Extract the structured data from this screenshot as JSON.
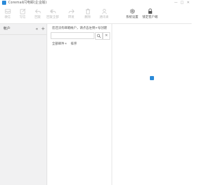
{
  "app": {
    "title": "Coremail闪电邮(企业版)"
  },
  "window_controls": [
    "—",
    "□",
    "✕"
  ],
  "toolbar": {
    "items": [
      {
        "label": "收信",
        "icon": "inbox-icon",
        "active": false
      },
      {
        "label": "写信",
        "icon": "compose-icon",
        "active": false
      },
      {
        "label": "回复",
        "icon": "reply-icon",
        "active": false
      },
      {
        "label": "回复全部",
        "icon": "reply-all-icon",
        "active": false
      },
      {
        "label": "转发",
        "icon": "forward-icon",
        "active": false
      },
      {
        "label": "删除",
        "icon": "delete-icon",
        "active": false
      },
      {
        "label": "通讯录",
        "icon": "contacts-icon",
        "active": false
      },
      {
        "label": "系统设置",
        "icon": "gear-icon",
        "active": true
      },
      {
        "label": "锁定客户端",
        "icon": "lock-icon",
        "active": true
      }
    ]
  },
  "left_panel": {
    "title": "帐户",
    "collapse_label": "«",
    "add_label": "+"
  },
  "middle_panel": {
    "notice": "您还没有邮箱帐户，请点击左侧+号创建",
    "search_placeholder": "",
    "search_button": "🔍",
    "clear_button": "✕",
    "filter_label": "全部邮件",
    "filter_caret": "▾",
    "sort_label": "排序"
  },
  "colors": {
    "accent": "#2b8ad8",
    "sidebar_bg": "#f1f1f2",
    "border": "#e2e2e2"
  }
}
